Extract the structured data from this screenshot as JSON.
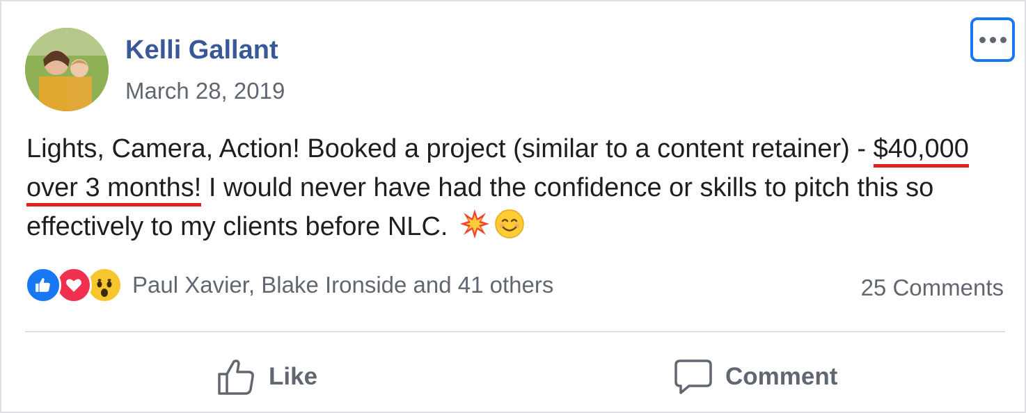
{
  "post": {
    "author": "Kelli Gallant",
    "date": "March 28, 2019",
    "text_before": "Lights, Camera, Action! Booked a project (similar to a content retainer) - ",
    "text_highlight": "$40,000 over 3 months!",
    "text_after": " I would never have had the confidence or skills to pitch this so effectively to my clients before NLC. ",
    "emojis": [
      "collision-emoji",
      "smiling-face-emoji"
    ]
  },
  "reactions": {
    "icons": [
      "like-reaction-icon",
      "love-reaction-icon",
      "wow-reaction-icon"
    ],
    "names": "Paul Xavier, Blake Ironside and 41 others",
    "comments": "25 Comments"
  },
  "actions": {
    "like_label": "Like",
    "comment_label": "Comment"
  },
  "colors": {
    "author": "#385898",
    "highlight_underline": "#e32020",
    "focus_border": "#1877f2",
    "like_reaction": "#1877f2",
    "love_reaction": "#f0304f",
    "wow_reaction": "#f7c62f"
  }
}
